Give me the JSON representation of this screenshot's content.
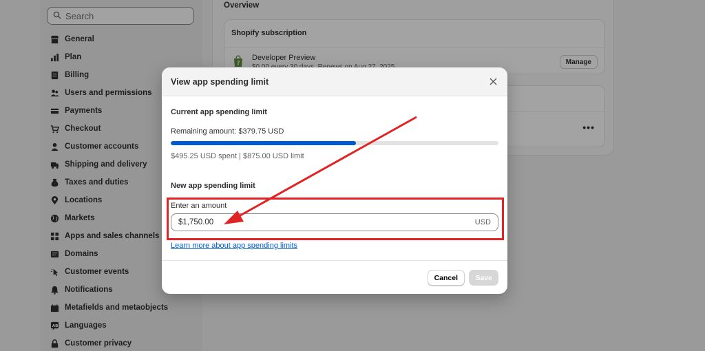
{
  "sidebar": {
    "search_placeholder": "Search",
    "items": [
      {
        "label": "General",
        "icon": "store-icon"
      },
      {
        "label": "Plan",
        "icon": "plan-icon"
      },
      {
        "label": "Billing",
        "icon": "billing-icon"
      },
      {
        "label": "Users and permissions",
        "icon": "users-icon"
      },
      {
        "label": "Payments",
        "icon": "payments-icon"
      },
      {
        "label": "Checkout",
        "icon": "cart-icon"
      },
      {
        "label": "Customer accounts",
        "icon": "person-icon"
      },
      {
        "label": "Shipping and delivery",
        "icon": "truck-icon"
      },
      {
        "label": "Taxes and duties",
        "icon": "tax-icon"
      },
      {
        "label": "Locations",
        "icon": "location-icon"
      },
      {
        "label": "Markets",
        "icon": "globe-icon"
      },
      {
        "label": "Apps and sales channels",
        "icon": "apps-icon"
      },
      {
        "label": "Domains",
        "icon": "domain-icon"
      },
      {
        "label": "Customer events",
        "icon": "cursor-icon"
      },
      {
        "label": "Notifications",
        "icon": "bell-icon"
      },
      {
        "label": "Metafields and metaobjects",
        "icon": "metafields-icon"
      },
      {
        "label": "Languages",
        "icon": "language-icon"
      },
      {
        "label": "Customer privacy",
        "icon": "lock-icon"
      }
    ]
  },
  "main": {
    "overview_title": "Overview",
    "subscription": {
      "title": "Shopify subscription",
      "plan_name": "Developer Preview",
      "plan_desc": "$0.00 every 30 days. Renews on Aug 27, 2025",
      "manage_label": "Manage"
    },
    "card2_menu": "•••"
  },
  "modal": {
    "title": "View app spending limit",
    "current_title": "Current app spending limit",
    "remaining": "Remaining amount: $379.75 USD",
    "progress_fraction": 0.566,
    "spent_line": "$495.25 USD spent | $875.00 USD limit",
    "new_title": "New app spending limit",
    "field_label": "Enter an amount",
    "field_value": "$1,750.00",
    "field_suffix": "USD",
    "learn_link": "Learn more about app spending limits",
    "cancel_label": "Cancel",
    "save_label": "Save"
  },
  "colors": {
    "accent": "#005bd3",
    "annotation": "#e02424",
    "save_disabled": "#d7d7d7"
  }
}
